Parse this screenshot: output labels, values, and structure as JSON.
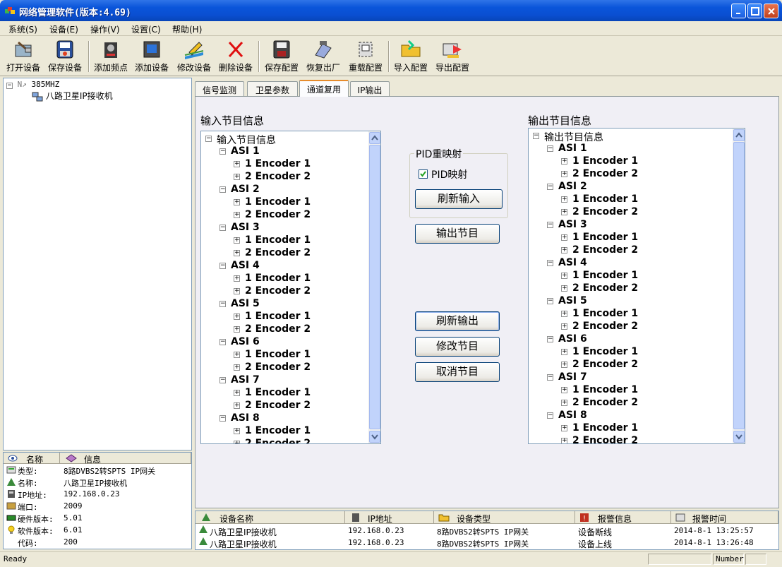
{
  "window": {
    "title": "网络管理软件(版本:4.69)"
  },
  "menu": [
    "系统(S)",
    "设备(E)",
    "操作(V)",
    "设置(C)",
    "帮助(H)"
  ],
  "toolbar": [
    {
      "label": "打开设备",
      "icon": "open-device-icon"
    },
    {
      "label": "保存设备",
      "icon": "save-device-icon"
    },
    {
      "label": "添加频点",
      "icon": "add-frequency-icon"
    },
    {
      "label": "添加设备",
      "icon": "add-device-icon"
    },
    {
      "label": "修改设备",
      "icon": "edit-device-icon"
    },
    {
      "label": "删除设备",
      "icon": "delete-device-icon"
    },
    {
      "label": "保存配置",
      "icon": "save-config-icon"
    },
    {
      "label": "恢复出厂",
      "icon": "factory-reset-icon"
    },
    {
      "label": "重载配置",
      "icon": "reload-config-icon"
    },
    {
      "label": "导入配置",
      "icon": "import-config-icon"
    },
    {
      "label": "导出配置",
      "icon": "export-config-icon"
    }
  ],
  "device_tree": {
    "root": "385MHZ",
    "child": "八路卫星IP接收机"
  },
  "info_panel": {
    "headers": {
      "name": "名称",
      "info": "信息"
    },
    "rows": [
      {
        "key": "类型:",
        "value": "8路DVBS2转SPTS IP网关"
      },
      {
        "key": "名称:",
        "value": "八路卫星IP接收机"
      },
      {
        "key": "IP地址:",
        "value": "192.168.0.23"
      },
      {
        "key": "端口:",
        "value": "2009"
      },
      {
        "key": "硬件版本:",
        "value": "5.01"
      },
      {
        "key": "软件版本:",
        "value": "6.01"
      },
      {
        "key": "代码:",
        "value": "200"
      }
    ]
  },
  "tabs": [
    "信号监测",
    "卫星参数",
    "通道复用",
    "IP输出"
  ],
  "active_tab": 2,
  "input_section": {
    "title": "输入节目信息",
    "root": "输入节目信息",
    "groups": [
      "ASI 1",
      "ASI 2",
      "ASI 3",
      "ASI 4",
      "ASI 5",
      "ASI 6",
      "ASI 7",
      "ASI 8"
    ],
    "children": [
      "1 Encoder 1",
      "2 Encoder 2"
    ]
  },
  "output_section": {
    "title": "输出节目信息",
    "root": "输出节目信息",
    "groups": [
      "ASI 1",
      "ASI 2",
      "ASI 3",
      "ASI 4",
      "ASI 5",
      "ASI 6",
      "ASI 7",
      "ASI 8"
    ],
    "children": [
      "1 Encoder 1",
      "2 Encoder 2"
    ]
  },
  "pid_group": {
    "legend": "PID重映射",
    "checkbox_label": "PID映射",
    "checked": true
  },
  "buttons": {
    "refresh_input": "刷新输入",
    "output_program": "输出节目",
    "refresh_output": "刷新输出",
    "modify_program": "修改节目",
    "cancel_program": "取消节目"
  },
  "alarm_list": {
    "headers": [
      "设备名称",
      "IP地址",
      "设备类型",
      "报警信息",
      "报警时间"
    ],
    "rows": [
      [
        "八路卫星IP接收机",
        "192.168.0.23",
        "8路DVBS2转SPTS IP网关",
        "设备断线",
        "2014-8-1 13:25:57"
      ],
      [
        "八路卫星IP接收机",
        "192.168.0.23",
        "8路DVBS2转SPTS IP网关",
        "设备上线",
        "2014-8-1 13:26:48"
      ]
    ]
  },
  "status": {
    "text": "Ready",
    "panel": "Number"
  }
}
